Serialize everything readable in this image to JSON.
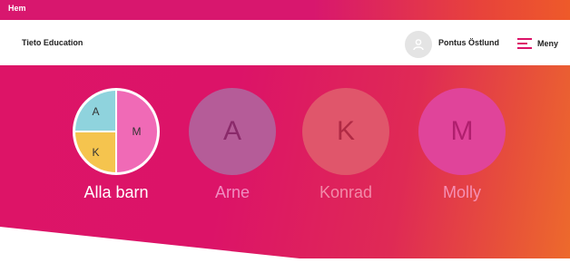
{
  "topbar": {
    "title": "Hem"
  },
  "header": {
    "brand": "Tieto Education",
    "user_name": "Pontus Östlund",
    "menu_label": "Meny"
  },
  "profiles": {
    "all": {
      "label": "Alla barn",
      "initials": [
        "A",
        "M",
        "K"
      ]
    },
    "items": [
      {
        "initial": "A",
        "name": "Arne",
        "color": "#b55c98"
      },
      {
        "initial": "K",
        "name": "Konrad",
        "color": "#e0566b"
      },
      {
        "initial": "M",
        "name": "Molly",
        "color": "#e0449a"
      }
    ]
  },
  "colors": {
    "brand_pink": "#dc1368",
    "brand_orange": "#ed6a2c",
    "all_a": "#8fd3dd",
    "all_k": "#f5c44e",
    "all_m": "#f06ab6"
  }
}
